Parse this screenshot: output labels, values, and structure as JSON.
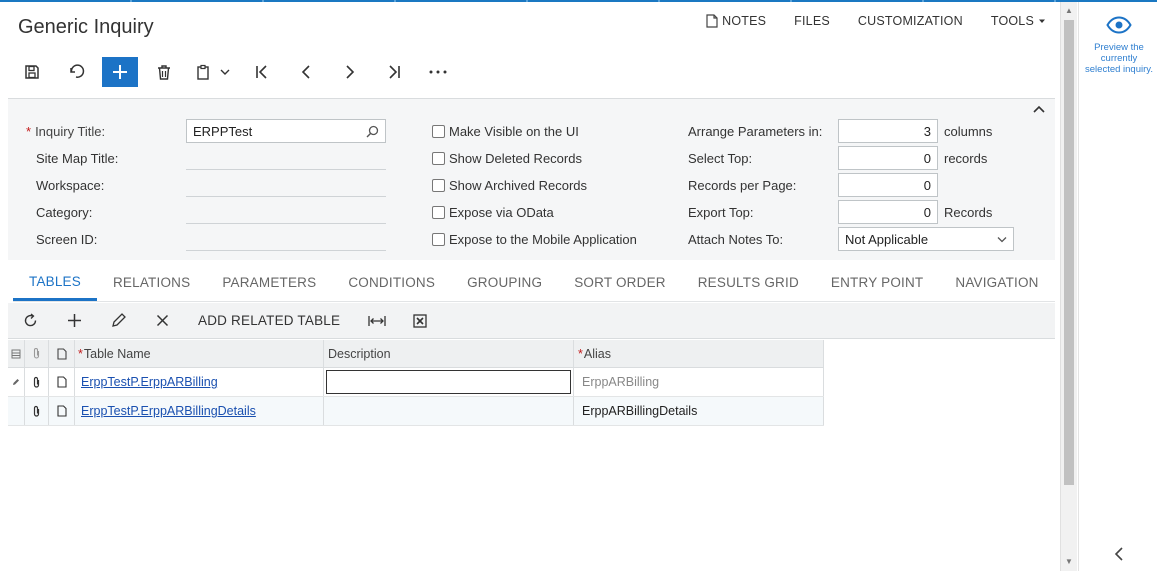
{
  "page": {
    "title": "Generic Inquiry"
  },
  "top_links": {
    "notes": "NOTES",
    "files": "FILES",
    "customization": "CUSTOMIZATION",
    "tools": "TOOLS"
  },
  "toolbar": {
    "icons": [
      "save-icon",
      "undo-icon",
      "add-icon",
      "delete-icon",
      "copy-paste-icon",
      "first-record-icon",
      "previous-record-icon",
      "next-record-icon",
      "last-record-icon",
      "more-icon"
    ]
  },
  "form": {
    "inquiry_title_label": "Inquiry Title:",
    "inquiry_title_value": "ERPPTest",
    "site_map_title_label": "Site Map Title:",
    "workspace_label": "Workspace:",
    "category_label": "Category:",
    "screen_id_label": "Screen ID:",
    "checkboxes": {
      "make_visible": "Make Visible on the UI",
      "show_deleted": "Show Deleted Records",
      "show_archived": "Show Archived Records",
      "expose_odata": "Expose via OData",
      "expose_mobile": "Expose to the Mobile Application"
    },
    "arrange_label": "Arrange Parameters in:",
    "arrange_value": "3",
    "arrange_unit": "columns",
    "select_top_label": "Select Top:",
    "select_top_value": "0",
    "select_top_unit": "records",
    "records_per_page_label": "Records per Page:",
    "records_per_page_value": "0",
    "export_top_label": "Export Top:",
    "export_top_value": "0",
    "export_top_unit": "Records",
    "attach_notes_label": "Attach Notes To:",
    "attach_notes_value": "Not Applicable"
  },
  "tabs": [
    "TABLES",
    "RELATIONS",
    "PARAMETERS",
    "CONDITIONS",
    "GROUPING",
    "SORT ORDER",
    "RESULTS GRID",
    "ENTRY POINT",
    "NAVIGATION"
  ],
  "grid_toolbar": {
    "add_related": "ADD RELATED TABLE"
  },
  "grid": {
    "columns": {
      "table_name": "Table Name",
      "description": "Description",
      "alias": "Alias"
    },
    "rows": [
      {
        "table_name": "ErppTestP.ErppARBilling",
        "description": "",
        "alias": "ErppARBilling"
      },
      {
        "table_name": "ErppTestP.ErppARBillingDetails",
        "description": "",
        "alias": "ErppARBillingDetails"
      }
    ]
  },
  "right_pane": {
    "preview_text": "Preview the currently selected inquiry."
  },
  "colors": {
    "accent": "#1c73c6",
    "link": "#1a50b0",
    "required": "#c21a1a"
  }
}
